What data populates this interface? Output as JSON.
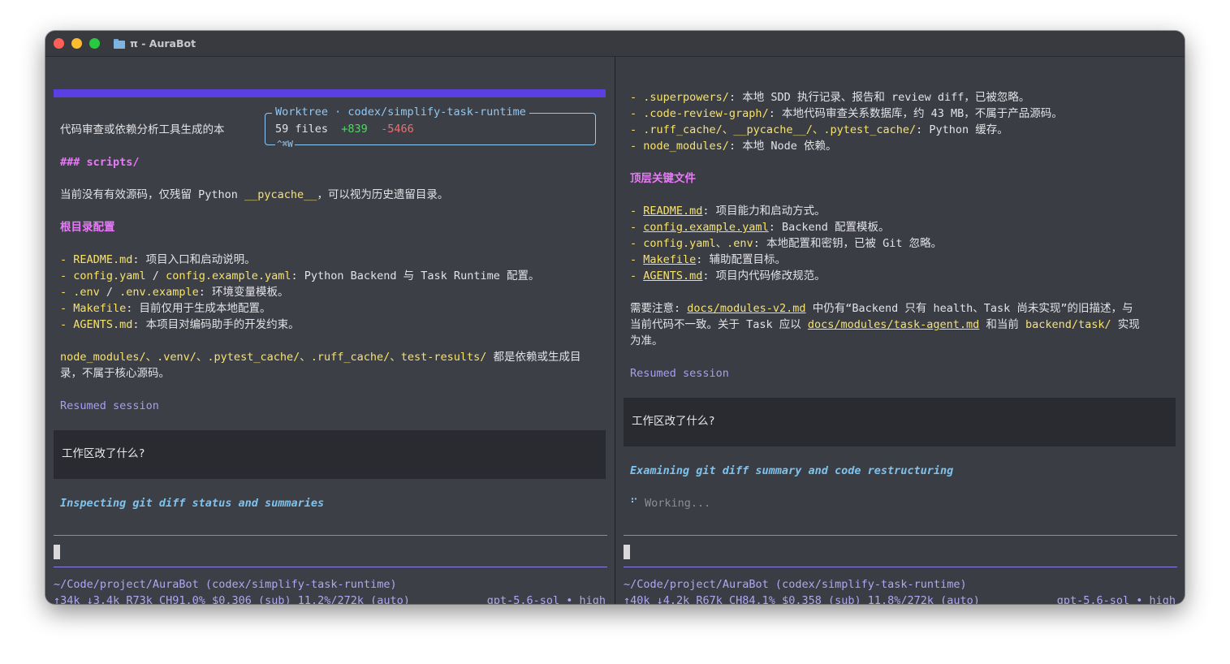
{
  "window": {
    "title": "π - AuraBot"
  },
  "left": {
    "worktree": {
      "legend": "Worktree · codex/simplify-task-runtime",
      "files": "59 files",
      "added": "+839",
      "removed": "-5466",
      "shortcut": "^⌘W"
    },
    "intro_line": "代码审查或依赖分析工具生成的本",
    "scripts_heading": "### scripts/",
    "scripts_text_a": "当前没有有效源码，仅残留 Python ",
    "scripts_text_code": "__pycache__",
    "scripts_text_b": "，可以视为历史遗留目录。",
    "root_heading": "根目录配置",
    "items": [
      {
        "dash": "- ",
        "code": "README.md",
        "text": ": 项目入口和启动说明。"
      },
      {
        "dash": "- ",
        "code": "config.yaml",
        "sep": " / ",
        "code2": "config.example.yaml",
        "text": ": Python Backend 与 Task Runtime 配置。"
      },
      {
        "dash": "- ",
        "code": ".env",
        "sep": " / ",
        "code2": ".env.example",
        "text": ": 环境变量模板。"
      },
      {
        "dash": "- ",
        "code": "Makefile",
        "text": ": 目前仅用于生成本地配置。"
      },
      {
        "dash": "- ",
        "code": "AGENTS.md",
        "text": ": 本项目对编码助手的开发约束。"
      }
    ],
    "deps_line1_code": "node_modules/、.venv/、.pytest_cache/、.ruff_cache/、test-results/",
    "deps_line1_text": " 都是依赖或生成目",
    "deps_line2": "录，不属于核心源码。",
    "resumed": "Resumed session",
    "user_message": "工作区改了什么?",
    "thinking": "Inspecting git diff status and summaries",
    "cwd": "~/Code/project/AuraBot (codex/simplify-task-runtime)",
    "stats": "↑34k ↓3.4k R73k CH91.0% $0.306 (sub) 11.2%/272k (auto)",
    "model": "gpt-5.6-sol • high"
  },
  "right": {
    "top_items": [
      {
        "dash": "- ",
        "code": ".superpowers/",
        "text": ": 本地 SDD 执行记录、报告和 review diff，已被忽略。"
      },
      {
        "dash": "- ",
        "code": ".code-review-graph/",
        "text": ": 本地代码审查关系数据库，约 43 MB，不属于产品源码。"
      },
      {
        "dash": "- ",
        "code": ".ruff_cache/、__pycache__/、.pytest_cache/",
        "text": ": Python 缓存。"
      },
      {
        "dash": "- ",
        "code": "node_modules/",
        "text": ": 本地 Node 依赖。"
      }
    ],
    "top_heading": "顶层关键文件",
    "key_items": [
      {
        "dash": "- ",
        "code": "README.md",
        "text": ": 项目能力和启动方式。",
        "link": true
      },
      {
        "dash": "- ",
        "code": "config.example.yaml",
        "text": ": Backend 配置模板。",
        "link": true
      },
      {
        "dash": "- ",
        "code": "config.yaml、.env",
        "text": ": 本地配置和密钥，已被 Git 忽略。",
        "link": false
      },
      {
        "dash": "- ",
        "code": "Makefile",
        "text": ": 辅助配置目标。",
        "link": true
      },
      {
        "dash": "- ",
        "code": "AGENTS.md",
        "text": ": 项目内代码修改规范。",
        "link": true
      }
    ],
    "note_l1_a": "需要注意: ",
    "note_l1_link": "docs/modules-v2.md",
    "note_l1_b": " 中仍有“Backend 只有 health、Task 尚未实现”的旧描述，与",
    "note_l2_a": "当前代码不一致。关于 Task 应以 ",
    "note_l2_link": "docs/modules/task-agent.md",
    "note_l2_b": " 和当前 ",
    "note_l2_code": "backend/task/",
    "note_l2_c": " 实现",
    "note_l3": "为准。",
    "resumed": "Resumed session",
    "user_message": "工作区改了什么?",
    "thinking": "Examining git diff summary and code restructuring",
    "spinner": "⠋",
    "working": "Working...",
    "cwd": "~/Code/project/AuraBot (codex/simplify-task-runtime)",
    "stats": "↑40k ↓4.2k R67k CH84.1% $0.358 (sub) 11.8%/272k (auto)",
    "model": "gpt-5.6-sol • high"
  }
}
